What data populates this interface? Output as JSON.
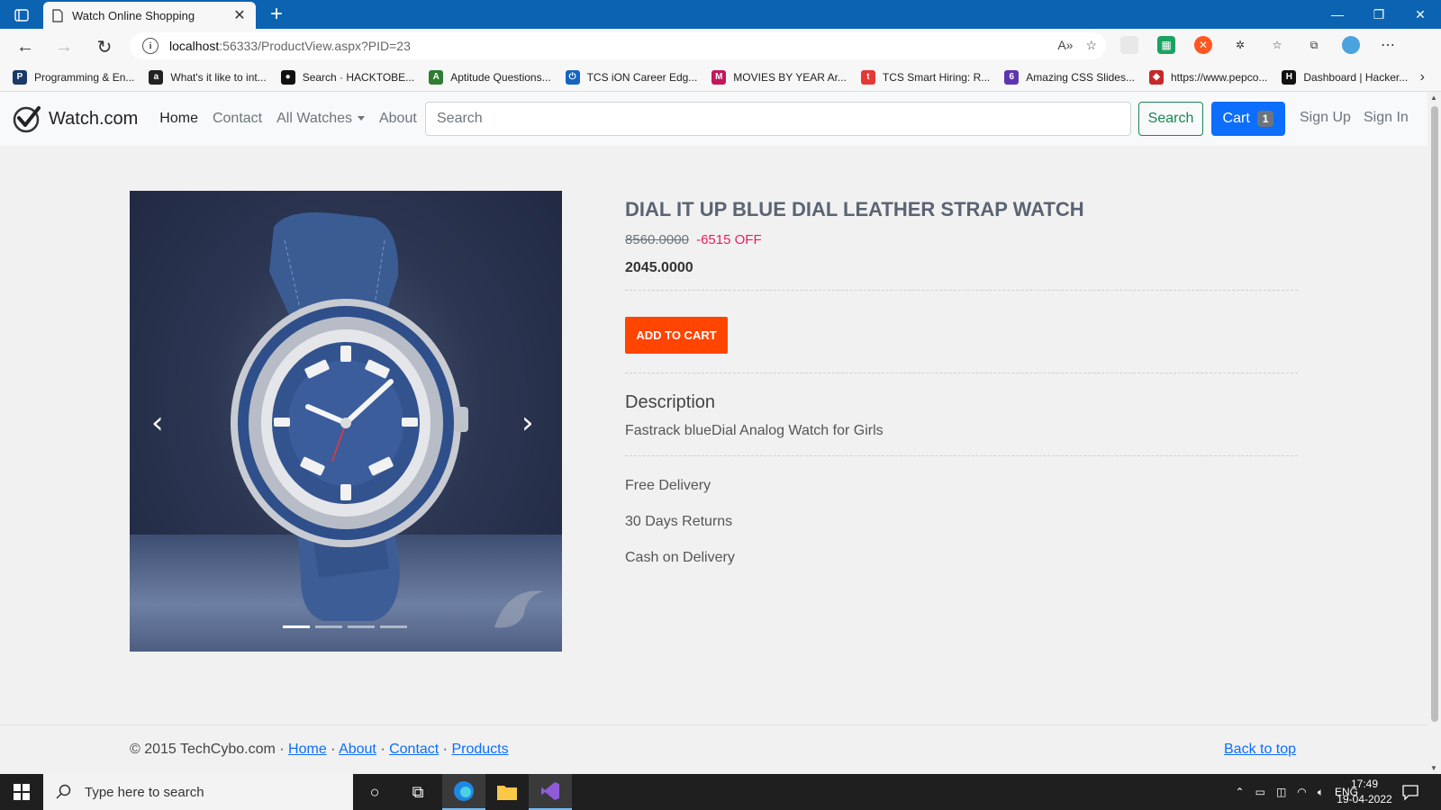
{
  "browser": {
    "tab_title": "Watch Online Shopping",
    "url_host": "localhost",
    "url_rest": ":56333/ProductView.aspx?PID=23",
    "accent": "#0b63b2",
    "bookmarks": [
      {
        "label": "Programming & En...",
        "icon": "programming-bookmark-icon",
        "color": "#1a3a6a",
        "glyph": "P"
      },
      {
        "label": "What's it like to int...",
        "icon": "amazon-icon",
        "color": "#222222",
        "glyph": "a"
      },
      {
        "label": "Search · HACKTOBE...",
        "icon": "github-icon",
        "color": "#111111",
        "glyph": "●"
      },
      {
        "label": "Aptitude Questions...",
        "icon": "aptitude-icon",
        "color": "#2e7d32",
        "glyph": "A"
      },
      {
        "label": "TCS iON Career Edg...",
        "icon": "power-icon",
        "color": "#1565c0",
        "glyph": "⏻"
      },
      {
        "label": "MOVIES BY YEAR Ar...",
        "icon": "movies-icon",
        "color": "#c2185b",
        "glyph": "M"
      },
      {
        "label": "TCS Smart Hiring: R...",
        "icon": "tcs-icon",
        "color": "#e53935",
        "glyph": "t"
      },
      {
        "label": "Amazing CSS Slides...",
        "icon": "css-slides-icon",
        "color": "#5e35b1",
        "glyph": "6"
      },
      {
        "label": "https://www.pepco...",
        "icon": "pepcoding-icon",
        "color": "#c62828",
        "glyph": "◆"
      },
      {
        "label": "Dashboard | Hacker...",
        "icon": "hackerrank-icon",
        "color": "#111111",
        "glyph": "H"
      }
    ]
  },
  "site": {
    "brand": "Watch.com",
    "nav": {
      "home": "Home",
      "contact": "Contact",
      "all_watches": "All Watches",
      "about": "About"
    },
    "search_placeholder": "Search",
    "search_button": "Search",
    "cart_label": "Cart",
    "cart_count": "1",
    "sign_up": "Sign Up",
    "sign_in": "Sign In"
  },
  "product": {
    "title": "DIAL IT UP BLUE DIAL LEATHER STRAP WATCH",
    "old_price": "8560.0000",
    "off_text": "-6515 OFF",
    "price": "2045.0000",
    "add_to_cart": "ADD TO CART",
    "description_heading": "Description",
    "description": "Fastrack blueDial Analog Watch for Girls",
    "features": [
      "Free Delivery",
      "30 Days Returns",
      "Cash on Delivery"
    ],
    "carousel": {
      "slides": 4,
      "active_slide": 1
    },
    "colors": {
      "add_to_cart": "#ff4500",
      "discount": "#e91e63",
      "cart_button": "#0d6efd",
      "search_button": "#198754"
    }
  },
  "footer": {
    "copyright": "© 2015 TechCybo.com ·",
    "links": {
      "home": "Home",
      "about": "About",
      "contact": "Contact",
      "products": "Products"
    },
    "back_to_top": "Back to top"
  },
  "taskbar": {
    "search_placeholder": "Type here to search",
    "language": "ENG",
    "time": "17:49",
    "date": "19-04-2022"
  }
}
